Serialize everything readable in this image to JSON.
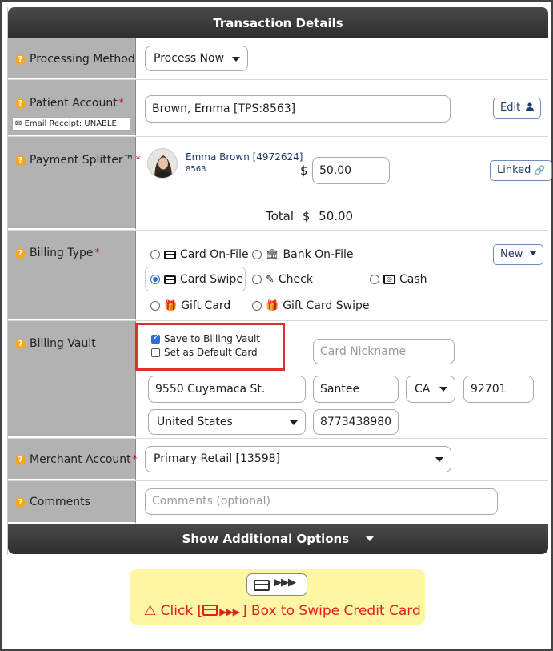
{
  "header": {
    "title": "Transaction Details"
  },
  "processing_method": {
    "label": "Processing Method",
    "value": "Process Now"
  },
  "patient_account": {
    "label": "Patient Account",
    "email_receipt": "Email Receipt: UNABLE",
    "value": "Brown, Emma [TPS:8563]",
    "edit_label": "Edit"
  },
  "payment_splitter": {
    "label": "Payment Splitter™",
    "patient_name": "Emma Brown [4972624]",
    "patient_id": "8563",
    "currency": "$",
    "amount": "50.00",
    "linked_label": "Linked",
    "total_label": "Total",
    "total_currency": "$",
    "total_amount": "50.00"
  },
  "billing_type": {
    "label": "Billing Type",
    "new_label": "New",
    "options": [
      {
        "label": "Card On-File",
        "selected": false
      },
      {
        "label": "Bank On-File",
        "selected": false
      },
      {
        "label": "Card Swipe",
        "selected": true
      },
      {
        "label": "Check",
        "selected": false
      },
      {
        "label": "Cash",
        "selected": false
      },
      {
        "label": "Gift Card",
        "selected": false
      },
      {
        "label": "Gift Card Swipe",
        "selected": false
      }
    ]
  },
  "billing_vault": {
    "label": "Billing Vault",
    "save_to_vault": {
      "label": "Save to Billing Vault",
      "checked": true
    },
    "set_default": {
      "label": "Set as Default Card",
      "checked": false
    },
    "card_nickname_placeholder": "Card Nickname",
    "address": "9550 Cuyamaca St.",
    "city": "Santee",
    "state": "CA",
    "zip": "92701",
    "country": "United States",
    "phone": "8773438980",
    "highlight_color": "#d9312b"
  },
  "merchant_account": {
    "label": "Merchant Account",
    "value": "Primary Retail [13598]"
  },
  "comments": {
    "label": "Comments",
    "placeholder": "Comments (optional)"
  },
  "footer": {
    "additional_options_label": "Show Additional Options"
  },
  "swipe_prompt": {
    "text_prefix": "Click [",
    "text_suffix": "] Box to Swipe Credit Card",
    "text_color": "#e02020",
    "background": "#fdf7a3"
  },
  "colors": {
    "label_bg": "#b2b2b2",
    "header_bg": "#3a3a3a",
    "help_icon": "#f5a623",
    "required": "#d0021b"
  }
}
